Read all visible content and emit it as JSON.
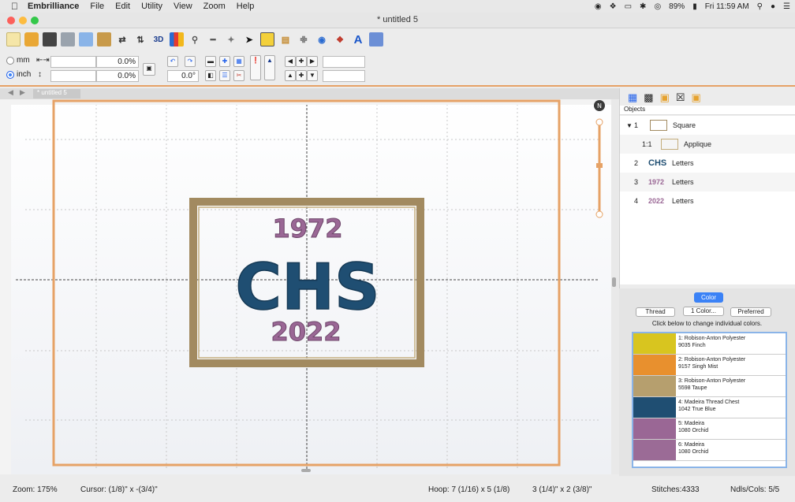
{
  "menubar": {
    "apple": "",
    "app": "Embrilliance",
    "items": [
      "File",
      "Edit",
      "Utility",
      "View",
      "Zoom",
      "Help"
    ],
    "battery": "89%",
    "time": "Fri 11:59 AM"
  },
  "window": {
    "title": "* untitled 5"
  },
  "toolbar": {
    "icons": [
      "new-file-icon",
      "open-folder-icon",
      "save-icon",
      "print-icon",
      "copy-icon",
      "paste-icon",
      "flip-horizontal-icon",
      "flip-vertical-icon",
      "3d-view-icon",
      "chart-icon",
      "magnify-icon",
      "ruler-icon",
      "stitch-icon",
      "pointer-icon",
      "text-box-icon",
      "thread-spool-icon",
      "needle-icon",
      "globe-icon",
      "apply-icon",
      "text-a-icon",
      "export-icon"
    ],
    "three_d": "3D",
    "a_label": "A"
  },
  "units": {
    "mm": "mm",
    "inch": "inch"
  },
  "fields": {
    "width": "",
    "width_pct": "0.0%",
    "height": "",
    "height_pct": "0.0%",
    "angle": "0.0°",
    "pos_x": "",
    "pos_y": ""
  },
  "doc_tab": "* untitled 5",
  "design": {
    "year_top": "1972",
    "main": "CHS",
    "year_bottom": "2022"
  },
  "colors": {
    "finch": "#d8c51f",
    "singh": "#e8902e",
    "taupe": "#b69f6e",
    "trueblue": "#1f4e72",
    "orchid": "#9a6795",
    "orchid2": "#9b6b96",
    "accent": "#e6a266"
  },
  "objects_panel": {
    "header": "Objects",
    "rows": [
      {
        "num": "1",
        "name": "Square"
      },
      {
        "num": "1:1",
        "name": "Applique"
      },
      {
        "num": "2",
        "thumb": "CHS",
        "name": "Letters"
      },
      {
        "num": "3",
        "thumb": "1972",
        "name": "Letters"
      },
      {
        "num": "4",
        "thumb": "2022",
        "name": "Letters"
      }
    ]
  },
  "color_panel": {
    "tab": "Color",
    "buttons": [
      "Thread",
      "1 Color...",
      "Preferred"
    ],
    "hint": "Click below to change individual colors.",
    "threads": [
      {
        "line1": "1: Robison-Anton Polyester",
        "line2": "9035 Finch"
      },
      {
        "line1": "2: Robison-Anton Polyester",
        "line2": "9157 Singh Mist"
      },
      {
        "line1": "3: Robison-Anton Polyester",
        "line2": "5598 Taupe"
      },
      {
        "line1": "4: Madeira Thread Chest",
        "line2": "1042 True Blue"
      },
      {
        "line1": "5: Madeira",
        "line2": "1080 Orchid"
      },
      {
        "line1": "6: Madeira",
        "line2": "1080 Orchid"
      }
    ]
  },
  "status": {
    "zoom": "Zoom: 175%",
    "cursor": "Cursor: (1/8)\" x -(3/4)\"",
    "hoop": "Hoop: 7 (1/16) x 5 (1/8)",
    "size": "3 (1/4)\" x 2 (3/8)\"",
    "stitches": "Stitches:4333",
    "ndls": "Ndls/Cols: 5/5"
  }
}
